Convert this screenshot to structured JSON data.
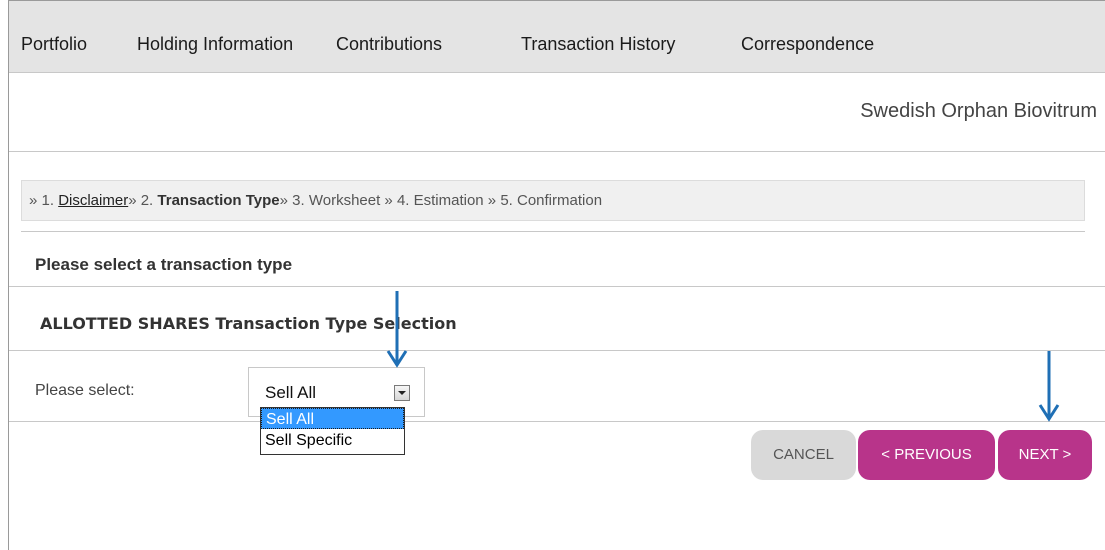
{
  "nav": {
    "items": [
      {
        "label": "Portfolio"
      },
      {
        "label": "Holding Information"
      },
      {
        "label": "Contributions"
      },
      {
        "label": "Transaction History"
      },
      {
        "label": "Correspondence"
      }
    ]
  },
  "company": "Swedish Orphan Biovitrum",
  "steps": {
    "prefix1": "» 1. ",
    "step1": "Disclaimer",
    "prefix2": "» 2. ",
    "step2": "Transaction Type",
    "rest": "» 3. Worksheet » 4. Estimation » 5. Confirmation"
  },
  "section_title": "Please select a transaction type",
  "sub_title": "ALLOTTED SHARES Transaction Type Selection",
  "select": {
    "label": "Please select:",
    "value": "Sell All",
    "options": [
      "Sell All",
      "Sell Specific"
    ]
  },
  "buttons": {
    "cancel": "CANCEL",
    "previous": "< PREVIOUS",
    "next": "NEXT >"
  },
  "colors": {
    "accent": "#b8348a",
    "highlight": "#3399ff",
    "annotation_arrow": "#1f6fb5"
  }
}
